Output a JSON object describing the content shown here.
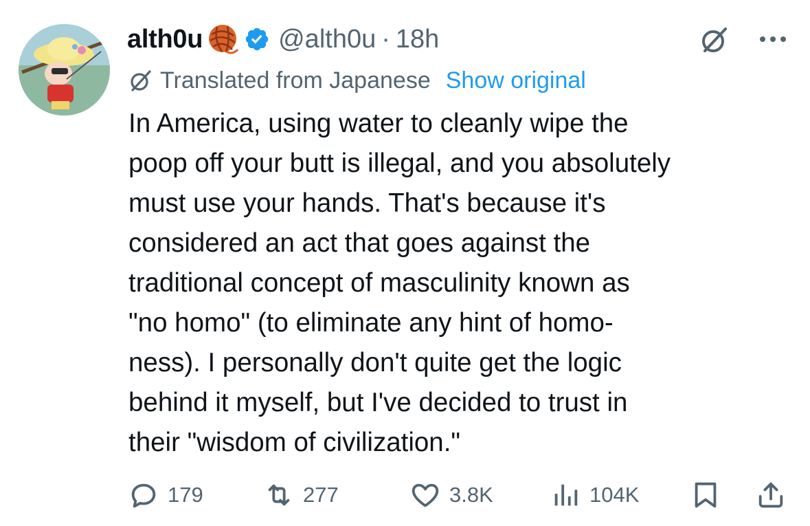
{
  "author": {
    "display_name": "alth0u",
    "handle": "@alth0u",
    "separator": "·",
    "time": "18h",
    "emoji_icon": "yarn-ball-icon",
    "verified_icon": "verified-badge-icon",
    "verified_color": "#1d9bf0"
  },
  "translation": {
    "label": "Translated from Japanese",
    "link": "Show original"
  },
  "tweet": {
    "lines": [
      "In America, using water to cleanly wipe the",
      "poop off your butt is illegal, and you absolutely",
      "must use your hands. That's because it's",
      "considered an act that goes against the",
      "traditional concept of masculinity known as",
      "\"no homo\" (to eliminate any hint of homo-",
      "ness). I personally don't quite get the logic",
      "behind it myself, but I've decided to trust in",
      "their \"wisdom of civilization.\""
    ]
  },
  "actions": {
    "replies": "179",
    "reposts": "277",
    "likes": "3.8K",
    "views": "104K"
  },
  "colors": {
    "text": "#0f1419",
    "secondary": "#536471",
    "link": "#1d9bf0"
  }
}
